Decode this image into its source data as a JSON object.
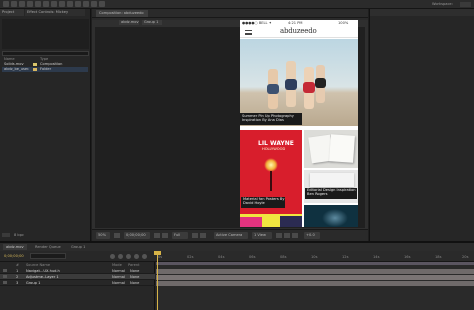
{
  "app": {
    "top_left_tab": "Project",
    "top_left_tab2": "Effect Controls: Mickey",
    "workspace_label": "Workspace:",
    "comp_tabs": [
      "Composition: abduzeedo",
      "abdz.mov",
      "Group 1"
    ],
    "comp_breadcrumb": [
      "abdz.mov",
      "Group 1"
    ]
  },
  "project": {
    "search_placeholder": "",
    "columns": [
      "Name",
      "Type"
    ],
    "items": [
      {
        "name": "Solids.mov",
        "type": "Composition",
        "color": "#d9c56b"
      },
      {
        "name": "abdz_be_user.",
        "type": "Folder",
        "color": "#d9b760"
      }
    ],
    "footer": "8 bpc"
  },
  "phone": {
    "status_left": "●●●●○ BELL ✦",
    "status_time": "4:21 PM",
    "status_right": "100%",
    "logo": "abduzeedo",
    "hero_caption_1": "Summer Pin Up Photography",
    "hero_caption_2": "Inspiration By Ana Dias",
    "card1_title": "LIL WAYNE",
    "card1_sub": "HOLLYWOOD",
    "card1_caption_1": "Material fan Posters By",
    "card1_caption_2": "David Hoyle",
    "card3_caption_1": "Editorial Design Inspiration",
    "card3_caption_2": "Ben Rogers"
  },
  "comp_bar": {
    "zoom": "50%",
    "timecode": "0;00;00;00",
    "resolution": "Full",
    "camera": "Active Camera",
    "views": "1 View",
    "offset": "+0.0"
  },
  "timeline": {
    "tabs": [
      "abdz.mov",
      "Render Queue",
      "Group 1"
    ],
    "timecode": "0;00;00;00",
    "columns": [
      "#",
      "Source Name",
      "Mode",
      "T",
      "TrkMat",
      "Parent"
    ],
    "layers": [
      {
        "num": "1",
        "name": "Navigat...UX.hud.h",
        "mode": "Normal",
        "parent": "None"
      },
      {
        "num": "2",
        "name": "Adjustme..Layer 1",
        "mode": "Normal",
        "parent": "None"
      },
      {
        "num": "3",
        "name": "Group 1",
        "mode": "Normal",
        "parent": "None"
      }
    ],
    "ruler": [
      "0s",
      "02s",
      "04s",
      "06s",
      "08s",
      "10s",
      "12s",
      "14s",
      "16s",
      "18s",
      "20s"
    ],
    "colors": {
      "playhead": "#d6b347",
      "layer_bar": "#6f6a6a",
      "work_area": "#5a5560"
    }
  }
}
